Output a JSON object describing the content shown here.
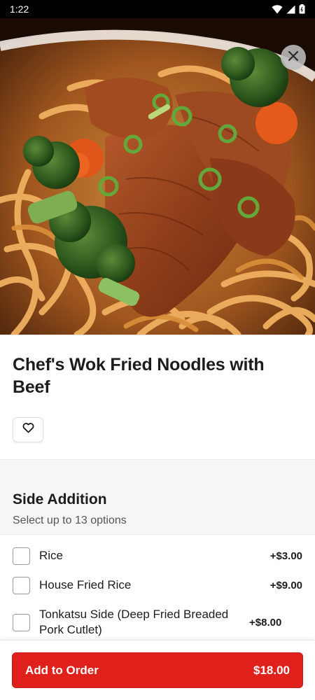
{
  "status_bar": {
    "time": "1:22"
  },
  "hero": {
    "image_alt": "Chef's Wok Fried Noodles with Beef"
  },
  "item": {
    "title": "Chef's Wok Fried Noodles with Beef"
  },
  "section": {
    "title": "Side Addition",
    "subtitle": "Select up to 13 options"
  },
  "options": [
    {
      "label": "Rice",
      "price": "+$3.00",
      "checked": false
    },
    {
      "label": "House Fried Rice",
      "price": "+$9.00",
      "checked": false
    },
    {
      "label": "Tonkatsu Side (Deep Fried Breaded Pork Cutlet)",
      "price": "+$8.00",
      "checked": false
    }
  ],
  "cta": {
    "label": "Add to Order",
    "price": "$18.00"
  },
  "colors": {
    "accent": "#e0211b",
    "background_band": "#f6f6f7"
  }
}
